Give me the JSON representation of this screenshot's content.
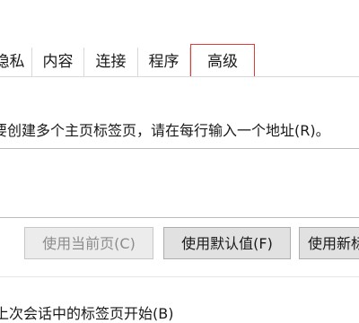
{
  "tabs": [
    {
      "label": "隐私"
    },
    {
      "label": "内容"
    },
    {
      "label": "连接"
    },
    {
      "label": "程序"
    },
    {
      "label": "高级"
    }
  ],
  "home_page": {
    "instruction": "要创建多个主页标签页，请在每行输入一个地址(R)。",
    "address_value": "",
    "buttons": {
      "use_current": "使用当前页(C)",
      "use_default": "使用默认值(F)",
      "use_new_tab": "使用新标"
    }
  },
  "startup": {
    "label_partial": "上次会话中的标签页开始(B)"
  },
  "colors": {
    "highlight": "#e03c3c"
  }
}
